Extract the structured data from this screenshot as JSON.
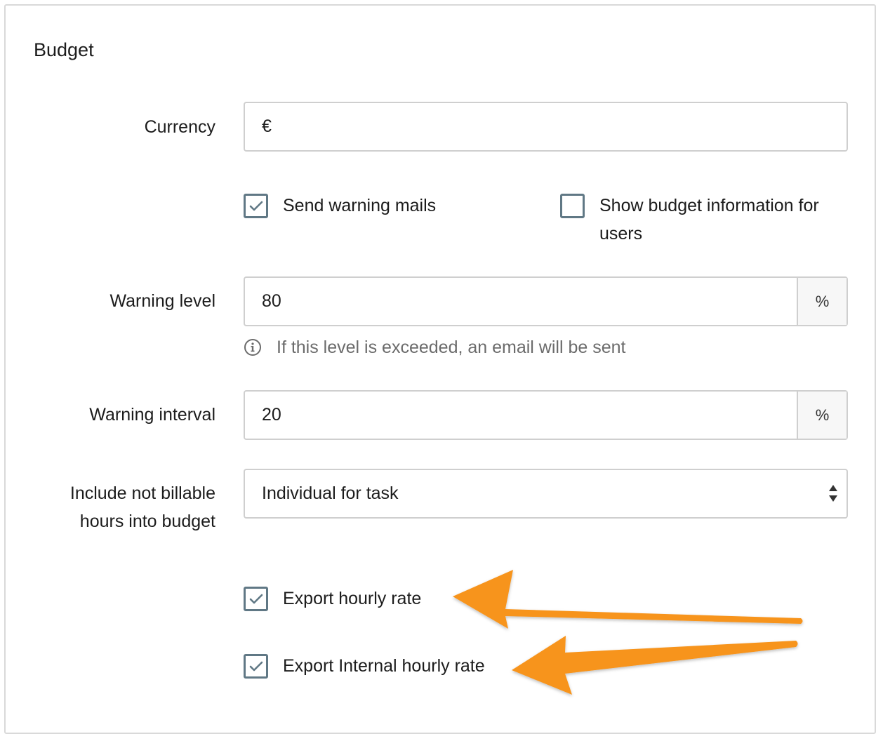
{
  "section": {
    "title": "Budget"
  },
  "currency": {
    "label": "Currency",
    "value": "€"
  },
  "send_warning_mails": {
    "label": "Send warning mails",
    "checked": true
  },
  "show_budget_info": {
    "label": "Show budget information for users",
    "checked": false
  },
  "warning_level": {
    "label": "Warning level",
    "value": "80",
    "unit": "%",
    "help": "If this level is exceeded, an email will be sent",
    "help_icon": "info-icon"
  },
  "warning_interval": {
    "label": "Warning interval",
    "value": "20",
    "unit": "%"
  },
  "include_not_billable": {
    "label_line1": "Include not billable",
    "label_line2": "hours into budget",
    "selected": "Individual for task"
  },
  "export_hourly_rate": {
    "label": "Export hourly rate",
    "checked": true
  },
  "export_internal_hourly_rate": {
    "label": "Export Internal hourly rate",
    "checked": true
  },
  "colors": {
    "checkbox_border": "#607885",
    "arrow": "#f7941d",
    "help_text": "#6b6b6b"
  }
}
